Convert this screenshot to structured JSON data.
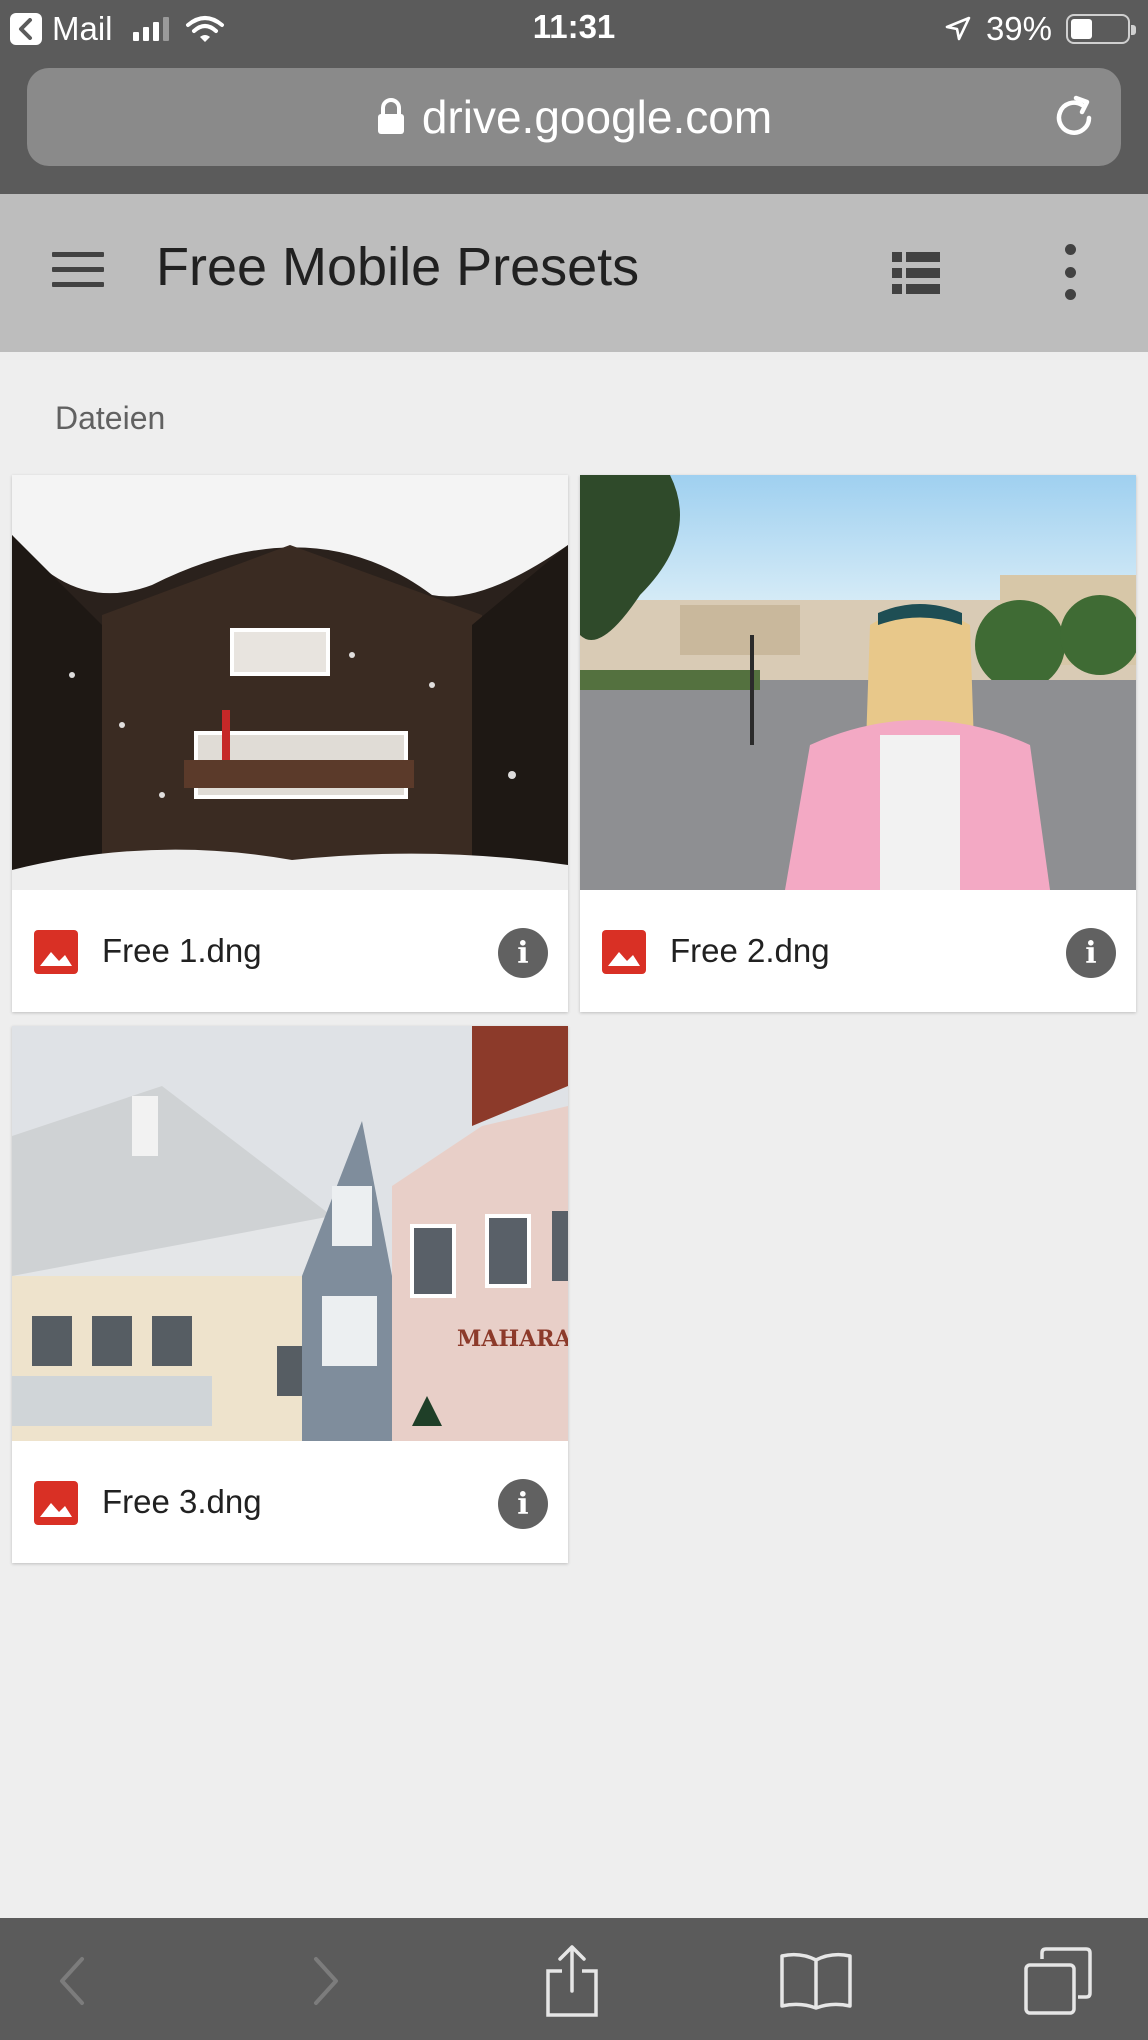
{
  "status_bar": {
    "back_app": "Mail",
    "time": "11:31",
    "battery": "39%",
    "battery_level": 0.39,
    "icons": [
      "back-chevron-icon",
      "signal-icon",
      "wifi-icon",
      "location-arrow-icon",
      "battery-icon"
    ]
  },
  "browser": {
    "url": "drive.google.com",
    "icons": [
      "lock-icon",
      "reload-icon"
    ]
  },
  "app_header": {
    "title": "Free Mobile Presets",
    "icons": [
      "hamburger-menu-icon",
      "list-view-icon",
      "more-vert-icon"
    ]
  },
  "section": {
    "label": "Dateien"
  },
  "files": [
    {
      "name": "Free 1.dng",
      "icon": "image-file-icon",
      "info_icon": "info-icon"
    },
    {
      "name": "Free 2.dng",
      "icon": "image-file-icon",
      "info_icon": "info-icon"
    },
    {
      "name": "Free 3.dng",
      "icon": "image-file-icon",
      "info_icon": "info-icon"
    }
  ],
  "toolbar": {
    "icons": [
      "back-icon",
      "forward-icon",
      "share-icon",
      "bookmarks-icon",
      "tabs-icon"
    ]
  },
  "colors": {
    "chrome_bg": "#5b5b5b",
    "header_bg": "#bdbdbd",
    "page_bg": "#eeeeee",
    "file_icon_red": "#d93025"
  }
}
